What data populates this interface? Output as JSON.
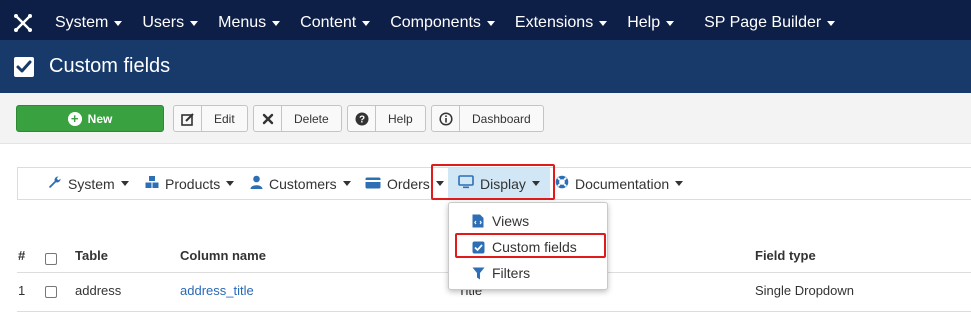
{
  "topnav": {
    "items": [
      {
        "label": "System",
        "has_caret": true
      },
      {
        "label": "Users",
        "has_caret": true
      },
      {
        "label": "Menus",
        "has_caret": true
      },
      {
        "label": "Content",
        "has_caret": true
      },
      {
        "label": "Components",
        "has_caret": true
      },
      {
        "label": "Extensions",
        "has_caret": true
      },
      {
        "label": "Help",
        "has_caret": true
      },
      {
        "label": "SP Page Builder",
        "has_caret": true
      }
    ]
  },
  "header": {
    "title": "Custom fields",
    "icon": "check-square-icon"
  },
  "toolbar": {
    "new_label": "New",
    "edit_label": "Edit",
    "delete_label": "Delete",
    "help_label": "Help",
    "dashboard_label": "Dashboard"
  },
  "subnav": {
    "items": [
      {
        "label": "System",
        "icon": "wrench-icon"
      },
      {
        "label": "Products",
        "icon": "cubes-icon"
      },
      {
        "label": "Customers",
        "icon": "user-icon"
      },
      {
        "label": "Orders",
        "icon": "credit-card-icon"
      },
      {
        "label": "Display",
        "icon": "monitor-icon",
        "active": true
      },
      {
        "label": "Documentation",
        "icon": "life-ring-icon"
      }
    ]
  },
  "dropdown": {
    "items": [
      {
        "label": "Views",
        "icon": "file-code-icon"
      },
      {
        "label": "Custom fields",
        "icon": "check-square-icon",
        "highlighted": true
      },
      {
        "label": "Filters",
        "icon": "filter-icon"
      }
    ]
  },
  "table": {
    "columns": {
      "num": "#",
      "table": "Table",
      "column_name": "Column name",
      "field_type": "Field type"
    },
    "rows": [
      {
        "num": "1",
        "table": "address",
        "column_name": "address_title",
        "label": "Title",
        "field_type": "Single Dropdown"
      }
    ]
  },
  "colors": {
    "topbar": "#0e1f47",
    "titlebar": "#173a6a",
    "new_button": "#3aa141",
    "highlight": "#e11b1b",
    "link": "#2a69b8",
    "active_tab": "#d2e7f6"
  }
}
